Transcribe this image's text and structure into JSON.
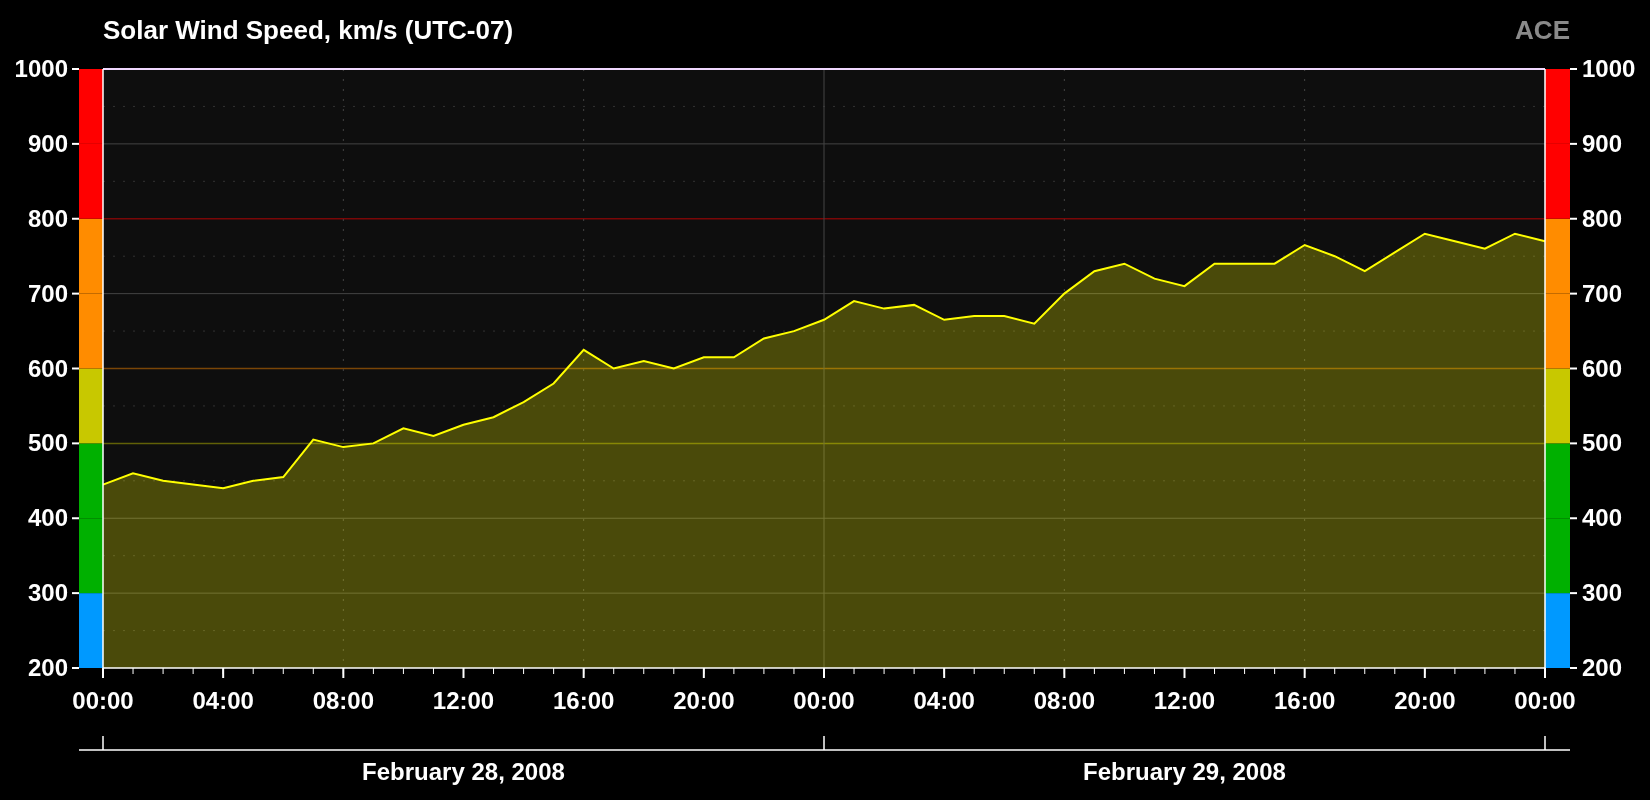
{
  "header": {
    "source": "ACE"
  },
  "chart": {
    "date_labels": [
      "February 28, 2008",
      "February 29, 2008"
    ],
    "right_axis_labels": [
      "1000",
      "900",
      "800",
      "700",
      "600",
      "500",
      "400",
      "300",
      "200"
    ],
    "chart_data": {
      "type": "area",
      "title": "Solar Wind Speed, km/s (UTC-07)",
      "grid": true,
      "x": [
        "2008-02-28T00:00",
        "2008-02-28T01:00",
        "2008-02-28T02:00",
        "2008-02-28T03:00",
        "2008-02-28T04:00",
        "2008-02-28T05:00",
        "2008-02-28T06:00",
        "2008-02-28T07:00",
        "2008-02-28T08:00",
        "2008-02-28T09:00",
        "2008-02-28T10:00",
        "2008-02-28T11:00",
        "2008-02-28T12:00",
        "2008-02-28T13:00",
        "2008-02-28T14:00",
        "2008-02-28T15:00",
        "2008-02-28T16:00",
        "2008-02-28T17:00",
        "2008-02-28T18:00",
        "2008-02-28T19:00",
        "2008-02-28T20:00",
        "2008-02-28T21:00",
        "2008-02-28T22:00",
        "2008-02-28T23:00",
        "2008-02-29T00:00",
        "2008-02-29T01:00",
        "2008-02-29T02:00",
        "2008-02-29T03:00",
        "2008-02-29T04:00",
        "2008-02-29T05:00",
        "2008-02-29T06:00",
        "2008-02-29T07:00",
        "2008-02-29T08:00",
        "2008-02-29T09:00",
        "2008-02-29T10:00",
        "2008-02-29T11:00",
        "2008-02-29T12:00",
        "2008-02-29T13:00",
        "2008-02-29T14:00",
        "2008-02-29T15:00",
        "2008-02-29T16:00",
        "2008-02-29T17:00",
        "2008-02-29T18:00",
        "2008-02-29T19:00",
        "2008-02-29T20:00",
        "2008-02-29T21:00",
        "2008-02-29T22:00",
        "2008-02-29T23:00",
        "2008-03-01T00:00"
      ],
      "series": [
        {
          "color": "#ffff00",
          "values": [
            445,
            460,
            450,
            445,
            440,
            450,
            455,
            505,
            495,
            500,
            520,
            510,
            525,
            535,
            555,
            580,
            625,
            600,
            610,
            600,
            615,
            615,
            640,
            650,
            665,
            690,
            680,
            685,
            665,
            670,
            670,
            660,
            700,
            730,
            740,
            720,
            710,
            740,
            740,
            740,
            765,
            750,
            730,
            755,
            780,
            770,
            760,
            780,
            770
          ]
        }
      ],
      "xlim": [
        "2008-02-28T00:00",
        "2008-03-01T00:00"
      ],
      "xticks": [
        {
          "value": "2008-02-28T00:00",
          "label": "00:00"
        },
        {
          "value": "2008-02-28T04:00",
          "label": "04:00"
        },
        {
          "value": "2008-02-28T08:00",
          "label": "08:00"
        },
        {
          "value": "2008-02-28T12:00",
          "label": "12:00"
        },
        {
          "value": "2008-02-28T16:00",
          "label": "16:00"
        },
        {
          "value": "2008-02-28T20:00",
          "label": "20:00"
        },
        {
          "value": "2008-02-29T00:00",
          "label": "00:00"
        },
        {
          "value": "2008-02-29T04:00",
          "label": "04:00"
        },
        {
          "value": "2008-02-29T08:00",
          "label": "08:00"
        },
        {
          "value": "2008-02-29T12:00",
          "label": "12:00"
        },
        {
          "value": "2008-02-29T16:00",
          "label": "16:00"
        },
        {
          "value": "2008-02-29T20:00",
          "label": "20:00"
        },
        {
          "value": "2008-03-01T00:00",
          "label": "00:00"
        }
      ],
      "ylim": [
        200,
        1000
      ],
      "yticks": [
        200,
        300,
        400,
        500,
        600,
        700,
        800,
        900,
        1000
      ],
      "ref_lines": [
        {
          "axis": "y",
          "value": 500,
          "color": "#c8c800"
        },
        {
          "axis": "y",
          "value": 600,
          "color": "#ff8c00"
        },
        {
          "axis": "y",
          "value": 800,
          "color": "#ff0000"
        }
      ]
    },
    "scale_segments": [
      {
        "color": "#0099ff"
      },
      {
        "color": "#00b000"
      },
      {
        "color": "#00b000"
      },
      {
        "color": "#c8c800"
      },
      {
        "color": "#ff8c00"
      },
      {
        "color": "#ff8c00"
      },
      {
        "color": "#ff0000"
      },
      {
        "color": "#ff0000"
      }
    ]
  }
}
